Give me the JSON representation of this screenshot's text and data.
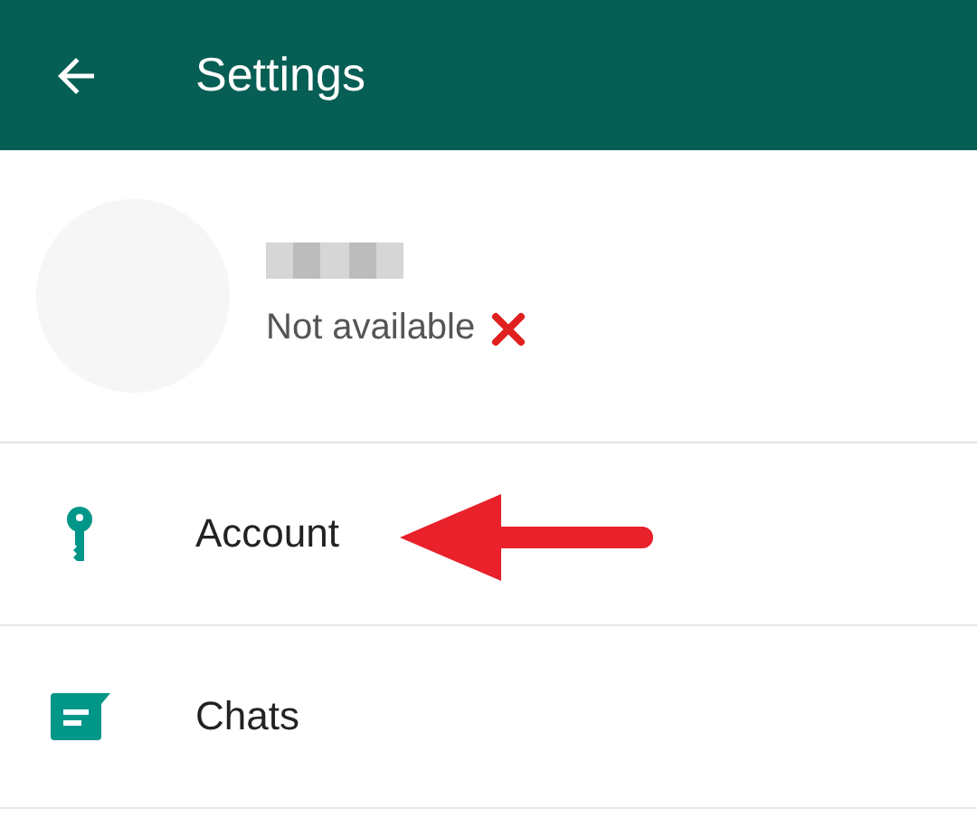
{
  "app_bar": {
    "title": "Settings"
  },
  "profile": {
    "status": "Not available"
  },
  "menu": [
    {
      "kind": "key",
      "label": "Account"
    },
    {
      "kind": "chat",
      "label": "Chats"
    }
  ]
}
